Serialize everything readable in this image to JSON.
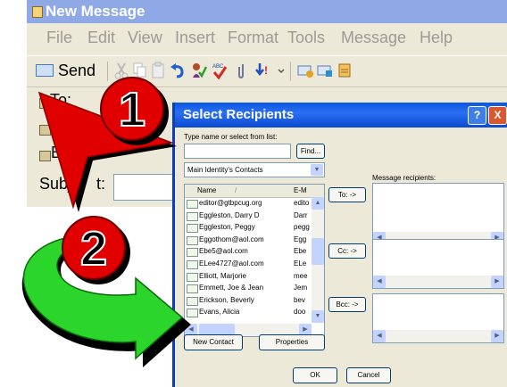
{
  "window": {
    "title": "New Message",
    "menu": [
      "File",
      "Edit",
      "View",
      "Insert",
      "Format",
      "Tools",
      "Message",
      "Help"
    ],
    "toolbar": {
      "send_label": "Send"
    },
    "headers": {
      "to": "To:",
      "bcc_partial": "B",
      "subject_partial_a": "Subj",
      "subject_partial_b": "t:"
    }
  },
  "dialog": {
    "title": "Select Recipients",
    "search_label": "Type name or select from list:",
    "search_value": "",
    "find_button": "Find...",
    "address_book": "Main Identity's Contacts",
    "columns": {
      "name": "Name",
      "email": "E-M"
    },
    "contacts": [
      {
        "name": "editor@gtbpcug.org",
        "email": "edito"
      },
      {
        "name": "Eggleston, Darry D",
        "email": "Darr"
      },
      {
        "name": "Eggleston, Peggy",
        "email": "pegg"
      },
      {
        "name": "Eggothom@aol.com",
        "email": "Egg"
      },
      {
        "name": "Ebe5@aol.com",
        "email": "Ebe"
      },
      {
        "name": "ELee4727@aol.com",
        "email": "ELe"
      },
      {
        "name": "Elliott, Marjorie",
        "email": "mee"
      },
      {
        "name": "Emmett, Joe & Jean",
        "email": "Jem"
      },
      {
        "name": "Erickson, Beverly",
        "email": "bev"
      },
      {
        "name": "Evans, Alicia",
        "email": "doo"
      }
    ],
    "recipients_label": "Message recipients:",
    "to_button": "To: ->",
    "cc_button": "Cc: ->",
    "bcc_button": "Bcc: ->",
    "new_contact_button": "New Contact",
    "properties_button": "Properties",
    "ok_button": "OK",
    "cancel_button": "Cancel",
    "help_button": "?",
    "close_button": "X"
  },
  "annotations": {
    "step1": "1",
    "step2": "2"
  },
  "colors": {
    "accent_red": "#e10000",
    "arrow_green": "#2bd52b",
    "title_blue": "#0a57e0"
  }
}
